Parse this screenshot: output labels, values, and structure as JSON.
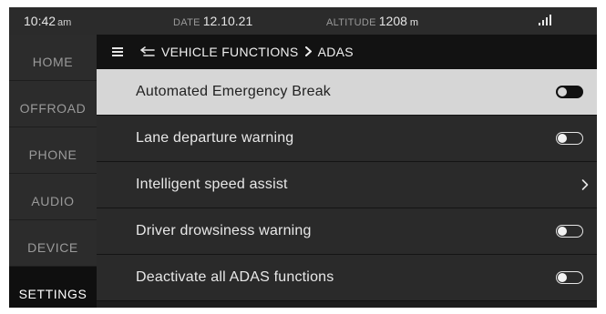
{
  "status": {
    "time": "10:42",
    "ampm": "am",
    "date_label": "DATE",
    "date": "12.10.21",
    "altitude_label": "ALTITUDE",
    "altitude": "1208",
    "altitude_unit": "m",
    "signal_icon": "signal-bars-icon"
  },
  "sidebar": {
    "items": [
      {
        "label": "HOME",
        "active": false
      },
      {
        "label": "OFFROAD",
        "active": false
      },
      {
        "label": "PHONE",
        "active": false
      },
      {
        "label": "AUDIO",
        "active": false
      },
      {
        "label": "DEVICE",
        "active": false
      },
      {
        "label": "SETTINGS",
        "active": true
      }
    ]
  },
  "header": {
    "breadcrumb_parent": "VEHICLE FUNCTIONS",
    "breadcrumb_current": "ADAS"
  },
  "list": {
    "items": [
      {
        "label": "Automated Emergency Break",
        "control": "toggle",
        "state": "off",
        "selected": true
      },
      {
        "label": "Lane departure warning",
        "control": "toggle",
        "state": "off",
        "selected": false
      },
      {
        "label": "Intelligent speed assist",
        "control": "chevron",
        "selected": false
      },
      {
        "label": "Driver drowsiness warning",
        "control": "toggle",
        "state": "off",
        "selected": false
      },
      {
        "label": "Deactivate all ADAS functions",
        "control": "toggle",
        "state": "off",
        "selected": false
      }
    ]
  },
  "colors": {
    "background": "#1e1e1e",
    "sidebar_item": "#2c2c2c",
    "sidebar_active": "#0f0f0f",
    "header": "#121212",
    "row": "#2a2a2a",
    "row_selected": "#d6d6d6"
  }
}
